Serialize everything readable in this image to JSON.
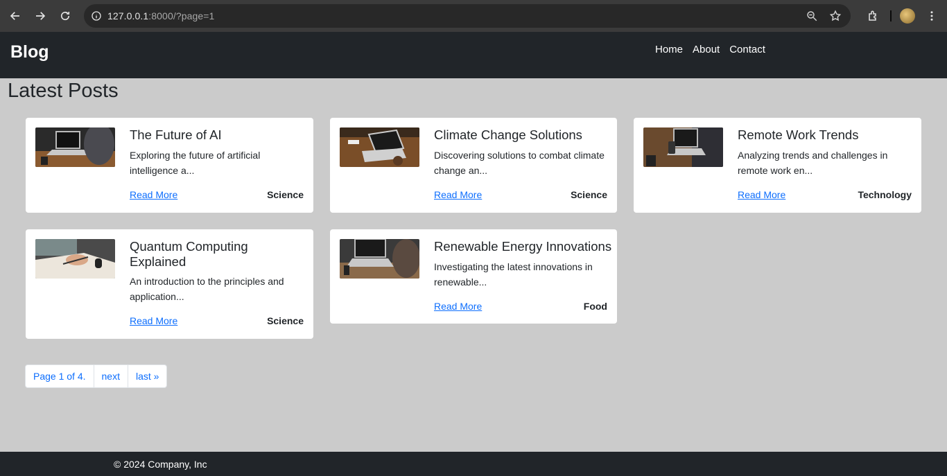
{
  "browser": {
    "url_host": "127.0.0.1",
    "url_rest": ":8000/?page=1"
  },
  "navbar": {
    "brand": "Blog",
    "links": [
      "Home",
      "About",
      "Contact"
    ]
  },
  "main": {
    "heading": "Latest Posts",
    "read_more_label": "Read More",
    "posts": [
      {
        "title": "The Future of AI",
        "excerpt": "Exploring the future of artificial intelligence a...",
        "category": "Science"
      },
      {
        "title": "Climate Change Solutions",
        "excerpt": "Discovering solutions to combat climate change an...",
        "category": "Science"
      },
      {
        "title": "Remote Work Trends",
        "excerpt": "Analyzing trends and challenges in remote work en...",
        "category": "Technology"
      },
      {
        "title": "Quantum Computing Explained",
        "excerpt": "An introduction to the principles and application...",
        "category": "Science"
      },
      {
        "title": "Renewable Energy Innovations",
        "excerpt": "Investigating the latest innovations in renewable...",
        "category": "Food"
      }
    ]
  },
  "pagination": {
    "current": "Page 1 of 4.",
    "next": "next",
    "last": "last »"
  },
  "footer": {
    "text": "© 2024 Company, Inc"
  },
  "colors": {
    "navbar_bg": "#212529",
    "page_bg": "#cbcbcb",
    "link": "#0d6efd"
  }
}
